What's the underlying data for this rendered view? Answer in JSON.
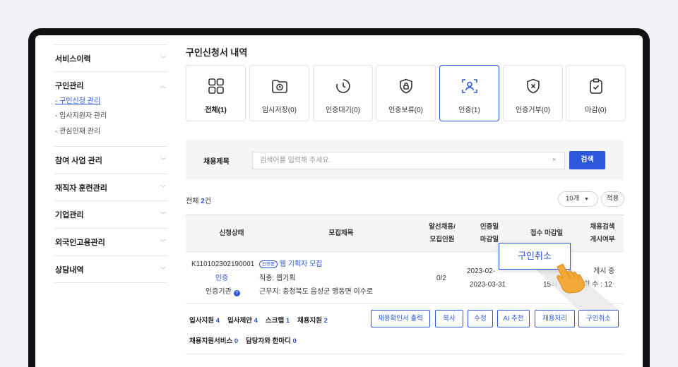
{
  "sidebar": {
    "service_history": "서비스이력",
    "job_mgmt": "구인관리",
    "job_sub": [
      "- 구인신청 관리",
      "- 입사지원자 관리",
      "- 관심인재 관리"
    ],
    "biz_mgmt": "참여 사업 관리",
    "training_mgmt": "재직자 훈련관리",
    "company_mgmt": "기업관리",
    "foreign_mgmt": "외국인고용관리",
    "consult": "상담내역"
  },
  "page_title": "구인신청서 내역",
  "status_cards": [
    {
      "label": "전체(1)",
      "icon": "grid-icon"
    },
    {
      "label": "임시저장(0)",
      "icon": "folder-clock-icon"
    },
    {
      "label": "인증대기(0)",
      "icon": "timer-icon"
    },
    {
      "label": "인증보류(0)",
      "icon": "shield-lock-icon"
    },
    {
      "label": "인증(1)",
      "icon": "scan-person-icon"
    },
    {
      "label": "인증거부(0)",
      "icon": "shield-x-icon"
    },
    {
      "label": "마감(0)",
      "icon": "clipboard-check-icon"
    }
  ],
  "search": {
    "label": "채용제목",
    "placeholder": "검색어를 입력해 주세요.",
    "clear": "×",
    "button": "검색"
  },
  "list": {
    "total_prefix": "전체 ",
    "total_count": "2",
    "total_suffix": "건",
    "per_page": "10개",
    "apply": "적용"
  },
  "table": {
    "headers": {
      "status": "신청상태",
      "title": "모집제목",
      "placement_1": "알선채용/",
      "placement_2": "모집인원",
      "cert_1": "인증일",
      "cert_2": "마감일",
      "deadline": "접수 마감일",
      "search_1": "채용검색",
      "search_2": "게시여부"
    },
    "row": {
      "id": "K110102302190001",
      "status": "인증",
      "cert_org": "인증기관",
      "cert_org_icon": "?",
      "badge": "진행중",
      "title": "웹 기획자 모집",
      "job_type": "직종: 웹기획",
      "location": "근무지: 충청북도 음성군 맹동면 이수로",
      "placement": "0/2",
      "cert_date": "2023-02-",
      "close_date": "2023-03-31",
      "deadline": "15시",
      "posted": "게시 중",
      "views": "조회 수 : 12"
    }
  },
  "stats": {
    "applicants_label": "입사지원",
    "applicants": "4",
    "offers_label": "입사제안",
    "offers": "4",
    "scrap_label": "스크랩",
    "scrap": "1",
    "support_label": "채용지원",
    "support": "2",
    "service_label": "채용지원서비스",
    "service": "0",
    "manager_label": "담당자와 한마디",
    "manager": "0"
  },
  "actions": [
    "채용확인서 출력",
    "복사",
    "수정",
    "AI 추천",
    "채용처리",
    "구인취소"
  ],
  "popup_label": "구인취소",
  "colors": {
    "accent": "#2b57d8",
    "frame": "#111111",
    "panel": "#f4f5f7"
  }
}
